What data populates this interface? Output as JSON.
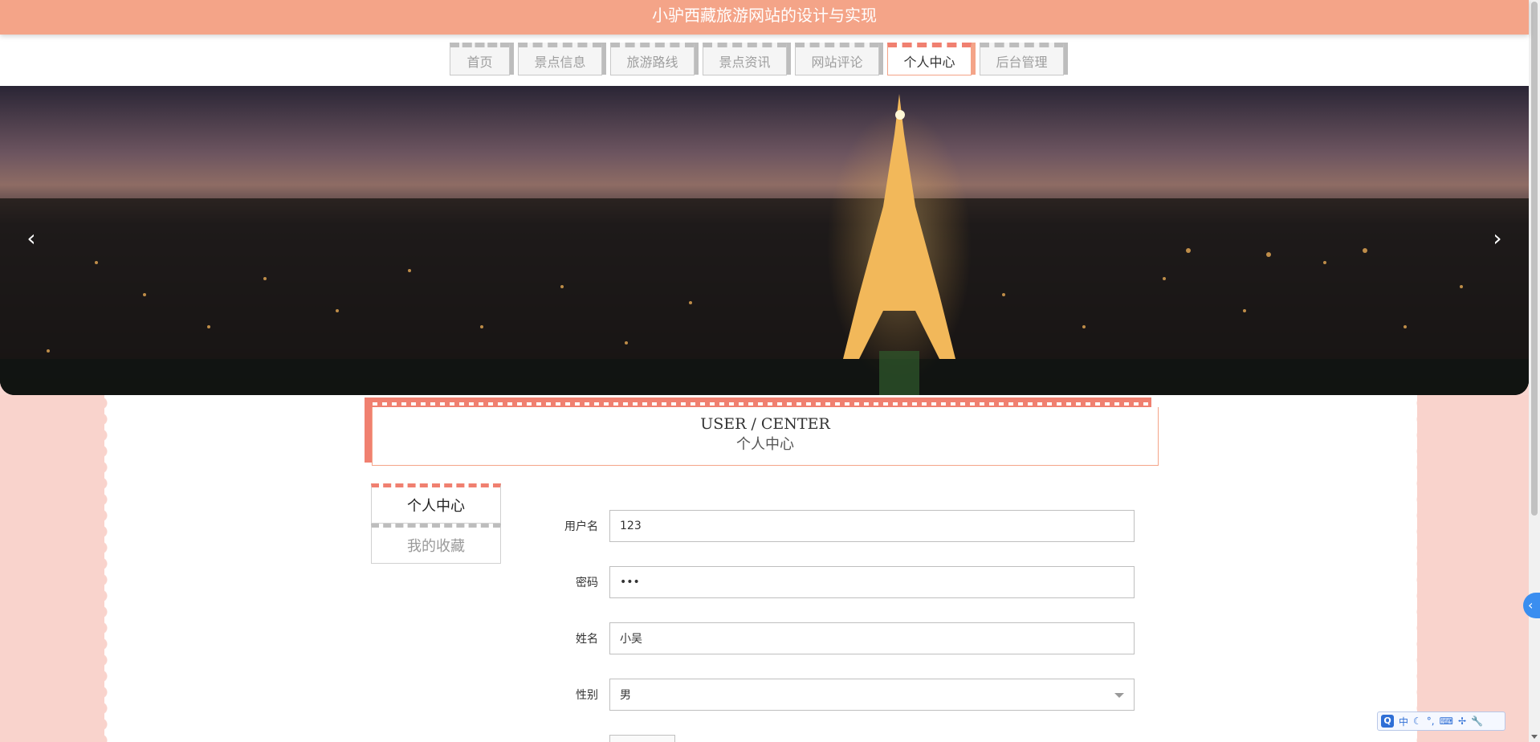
{
  "site": {
    "title": "小驴西藏旅游网站的设计与实现"
  },
  "nav": {
    "items": [
      {
        "label": "首页"
      },
      {
        "label": "景点信息"
      },
      {
        "label": "旅游路线"
      },
      {
        "label": "景点资讯"
      },
      {
        "label": "网站评论"
      },
      {
        "label": "个人中心",
        "active": true
      },
      {
        "label": "后台管理"
      }
    ]
  },
  "banner": {
    "prev_icon": "‹",
    "next_icon": "›"
  },
  "page_header": {
    "title_en": "USER / CENTER",
    "title_cn": "个人中心"
  },
  "menu": {
    "items": [
      {
        "label": "个人中心",
        "active": true
      },
      {
        "label": "我的收藏"
      }
    ]
  },
  "form": {
    "username": {
      "label": "用户名",
      "value": "123"
    },
    "password": {
      "label": "密码",
      "value": "•••"
    },
    "name": {
      "label": "姓名",
      "value": "小吴"
    },
    "gender": {
      "label": "性别",
      "value": "男"
    }
  },
  "side_tab": {
    "icon": "‹"
  },
  "ime": {
    "q": "Q",
    "lang": "中"
  },
  "colors": {
    "accent": "#f08070",
    "header_bg": "#f4a488",
    "page_bg": "#f8d6d0"
  }
}
